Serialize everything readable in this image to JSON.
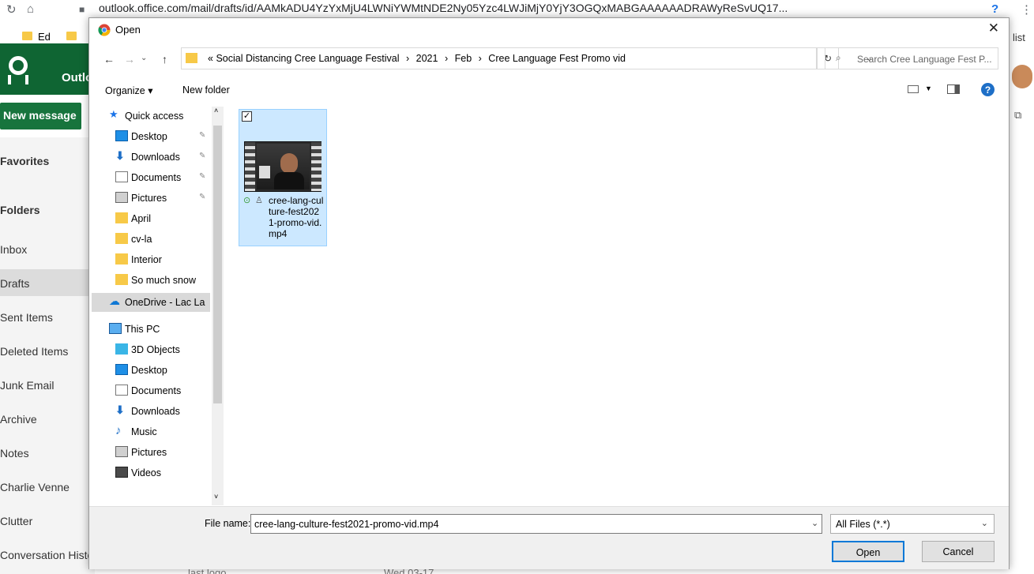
{
  "browser": {
    "url": "outlook.office.com/mail/drafts/id/AAMkADU4YzYxMjU4LWNiYWMtNDE2Ny05Yzc4LWJiMjY0YjY3OGQxMABGAAAAAADRAWyReSvUQ17...",
    "bookmarks": [
      "Ed"
    ],
    "right_label": "list"
  },
  "outlook": {
    "app_name": "Outlook",
    "new_message": "New message",
    "nav": [
      "Favorites",
      "Folders",
      "Inbox",
      "Drafts",
      "Sent Items",
      "Deleted Items",
      "Junk Email",
      "Archive",
      "Notes",
      "Charlie Venne",
      "Clutter",
      "Conversation History"
    ],
    "bottom_peek": [
      "last logo",
      "Wed 03-17"
    ]
  },
  "dialog": {
    "title": "Open",
    "breadcrumbs": [
      "«",
      "Social Distancing Cree Language Festival",
      "›",
      "2021",
      "›",
      "Feb",
      "›",
      "Cree Language Fest Promo vid"
    ],
    "search_placeholder": "Search Cree Language Fest P...",
    "toolbar": {
      "organize": "Organize ▾",
      "new_folder": "New folder"
    },
    "tree": [
      {
        "label": "Quick access",
        "icon": "star-icon",
        "indent": 0
      },
      {
        "label": "Desktop",
        "icon": "desktop-icon",
        "indent": 1,
        "pin": true
      },
      {
        "label": "Downloads",
        "icon": "download-icon",
        "indent": 1,
        "pin": true
      },
      {
        "label": "Documents",
        "icon": "document-icon",
        "indent": 1,
        "pin": true
      },
      {
        "label": "Pictures",
        "icon": "pictures-icon",
        "indent": 1,
        "pin": true
      },
      {
        "label": "April",
        "icon": "folder-icon",
        "indent": 1
      },
      {
        "label": "cv-la",
        "icon": "folder-icon",
        "indent": 1
      },
      {
        "label": "Interior",
        "icon": "folder-icon",
        "indent": 1
      },
      {
        "label": "So much snow",
        "icon": "folder-icon",
        "indent": 1
      },
      {
        "label": "OneDrive - Lac La",
        "icon": "cloud-icon",
        "indent": 0,
        "selected": true
      },
      {
        "label": "This PC",
        "icon": "pc-icon",
        "indent": 0
      },
      {
        "label": "3D Objects",
        "icon": "cube-icon",
        "indent": 1
      },
      {
        "label": "Desktop",
        "icon": "desktop-icon",
        "indent": 1
      },
      {
        "label": "Documents",
        "icon": "document-icon",
        "indent": 1
      },
      {
        "label": "Downloads",
        "icon": "download-icon",
        "indent": 1
      },
      {
        "label": "Music",
        "icon": "music-icon",
        "indent": 1
      },
      {
        "label": "Pictures",
        "icon": "pictures-icon",
        "indent": 1
      },
      {
        "label": "Videos",
        "icon": "video-icon",
        "indent": 1
      }
    ],
    "file": {
      "name": "cree-lang-culture-fest2021-promo-vid.mp4",
      "checked": true
    },
    "file_name_label": "File name:",
    "file_name_value": "cree-lang-culture-fest2021-promo-vid.mp4",
    "file_type": "All Files (*.*)",
    "open_label": "Open",
    "cancel_label": "Cancel"
  },
  "colors": {
    "outlook_green": "#0f6533",
    "selection": "#cce8ff",
    "folder": "#f7c948",
    "accent": "#0078d7"
  }
}
